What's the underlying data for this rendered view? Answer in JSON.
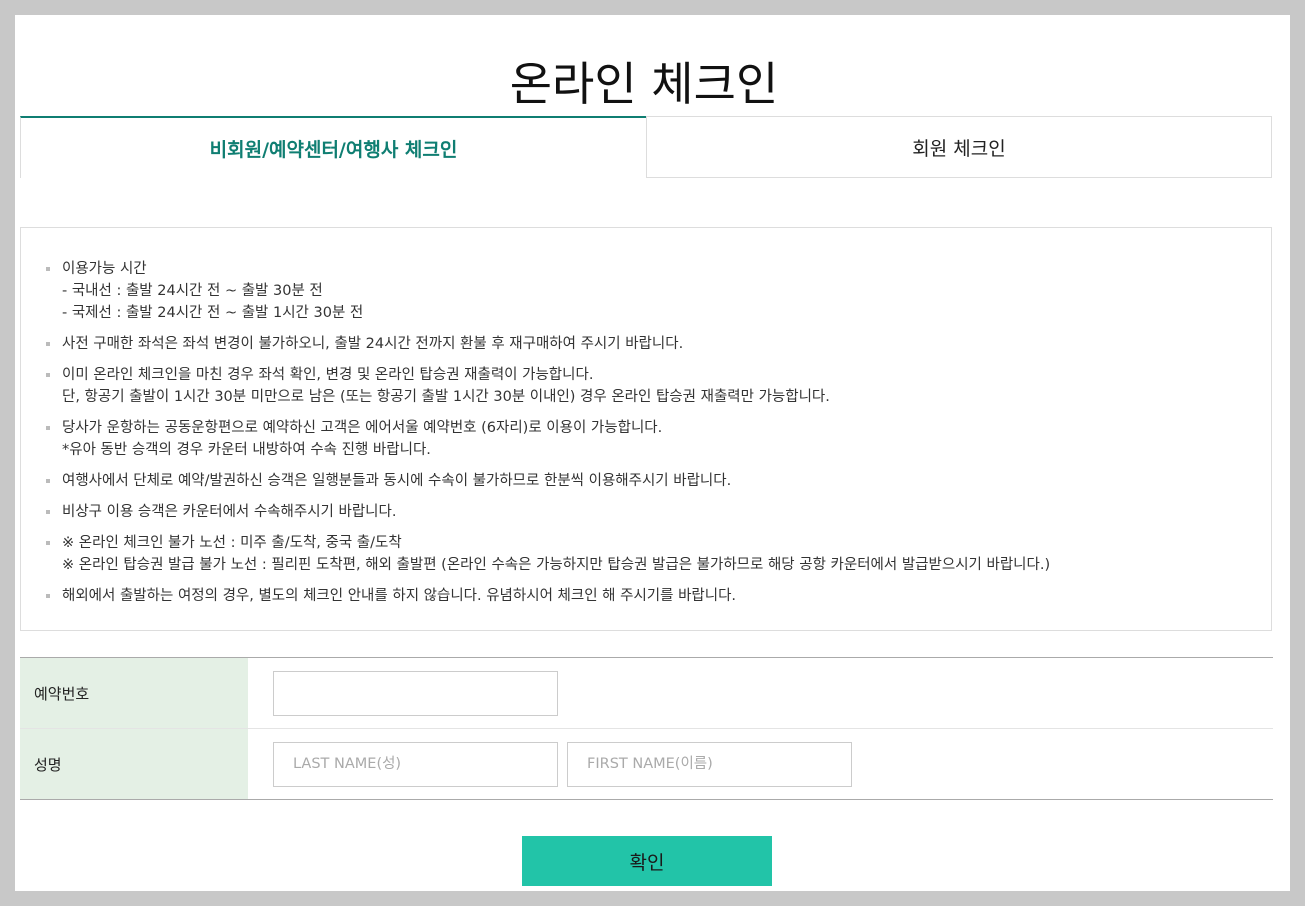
{
  "page_title": "온라인 체크인",
  "tabs": [
    {
      "label": "비회원/예약센터/여행사 체크인",
      "active": true
    },
    {
      "label": "회원 체크인",
      "active": false
    }
  ],
  "notice": [
    {
      "lines": [
        "이용가능 시간",
        "- 국내선 : 출발 24시간 전 ~ 출발 30분 전",
        "- 국제선 : 출발 24시간 전 ~ 출발 1시간 30분 전"
      ]
    },
    {
      "lines": [
        "사전 구매한 좌석은 좌석 변경이 불가하오니, 출발 24시간 전까지 환불 후 재구매하여 주시기 바랍니다."
      ]
    },
    {
      "lines": [
        "이미 온라인 체크인을 마친 경우 좌석 확인, 변경 및 온라인 탑승권 재출력이 가능합니다.",
        "단, 항공기 출발이 1시간 30분 미만으로 남은 (또는 항공기 출발 1시간 30분 이내인) 경우 온라인 탑승권 재출력만 가능합니다."
      ]
    },
    {
      "lines": [
        "당사가 운항하는 공동운항편으로 예약하신 고객은 에어서울 예약번호 (6자리)로 이용이 가능합니다.",
        "*유아 동반 승객의 경우 카운터 내방하여 수속 진행 바랍니다."
      ]
    },
    {
      "lines": [
        "여행사에서 단체로 예약/발권하신 승객은 일행분들과 동시에 수속이 불가하므로 한분씩 이용해주시기 바랍니다."
      ]
    },
    {
      "lines": [
        "비상구 이용 승객은 카운터에서 수속해주시기 바랍니다."
      ]
    },
    {
      "lines": [
        "※ 온라인 체크인 불가 노선 : 미주 출/도착, 중국 출/도착",
        "※ 온라인 탑승권 발급 불가 노선 : 필리핀 도착편, 해외 출발편 (온라인 수속은 가능하지만 탑승권 발급은 불가하므로 해당 공항 카운터에서 발급받으시기 바랍니다.)"
      ]
    },
    {
      "lines": [
        "해외에서 출발하는 여정의 경우, 별도의 체크인 안내를 하지 않습니다. 유념하시어 체크인 해 주시기를 바랍니다."
      ]
    }
  ],
  "form": {
    "reservation": {
      "label": "예약번호",
      "value": "",
      "placeholder": ""
    },
    "name": {
      "label": "성명",
      "last_placeholder": "LAST NAME(성)",
      "first_placeholder": "FIRST NAME(이름)",
      "last_value": "",
      "first_value": ""
    }
  },
  "confirm_label": "확인",
  "colors": {
    "accent": "#0f7e72",
    "button": "#22c4a8",
    "label_bg": "#e4f0e5",
    "page_bg": "#c8c8c8"
  }
}
